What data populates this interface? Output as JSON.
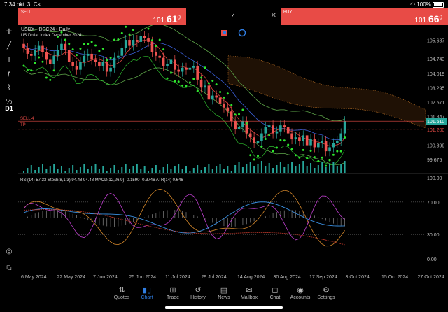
{
  "status_bar": {
    "time": "7:34",
    "date": "okt. 3. Cs",
    "battery": "100%"
  },
  "trade": {
    "sell_label": "SELL",
    "sell_price_main": "101.",
    "sell_price_big": "61",
    "sell_price_sup": "0",
    "buy_label": "BUY",
    "buy_price_main": "101.",
    "buy_price_big": "66",
    "buy_price_sup": "0",
    "quantity": "4"
  },
  "toolbar": {
    "items": [
      "crosshair-icon",
      "line-tool-icon",
      "text-tool-icon",
      "function-icon",
      "indicator-icon",
      "percent-icon"
    ],
    "timeframe": "D1"
  },
  "chart_header": {
    "symbol": "USDX - DEC24 • Daily",
    "name": "US Dollar Index December 2024"
  },
  "order_labels": {
    "sell": "SELL 4",
    "tp": "TP"
  },
  "indicator_label": "RSI(14) 57.33 Stoch(8,1,3) 94.48 94.48 MACD(12,26,9) -0.1590 -0.3746 ATR(14) 0.646",
  "colors": {
    "accent": "#2f7de1",
    "sell": "#e84b46",
    "bull": "#26a69a",
    "bear": "#ef5350"
  },
  "chart_data": {
    "type": "candlestick",
    "price_ticks": [
      "105.687",
      "104.743",
      "104.019",
      "103.295",
      "102.571",
      "101.847",
      "101.610",
      "101.200",
      "100.399",
      "99.675"
    ],
    "price_tick_values": [
      105.687,
      104.743,
      104.019,
      103.295,
      102.571,
      101.847,
      101.61,
      101.2,
      100.399,
      99.675
    ],
    "price_range": [
      99.4,
      106.3
    ],
    "current_price": "101.610",
    "tp_price": "101.200",
    "osc_ticks": [
      "100.00",
      "70.00",
      "30.00",
      "0.00"
    ],
    "osc_tick_values": [
      100,
      70,
      30,
      0
    ],
    "x_labels": [
      "6 May 2024",
      "22 May 2024",
      "7 Jun 2024",
      "25 Jun 2024",
      "11 Jul 2024",
      "29 Jul 2024",
      "14 Aug 2024",
      "30 Aug 2024",
      "17 Sep 2024",
      "3 Oct 2024",
      "15 Oct 2024",
      "27 Oct 2024"
    ],
    "close": [
      105.3,
      105.0,
      104.9,
      105.2,
      105.4,
      105.1,
      104.7,
      104.5,
      104.9,
      105.2,
      105.5,
      105.2,
      104.6,
      104.4,
      104.2,
      104.6,
      104.9,
      105.0,
      104.7,
      104.6,
      104.4,
      104.6,
      104.1,
      104.3,
      104.8,
      104.9,
      105.3,
      105.7,
      105.4,
      105.7,
      105.6,
      105.9,
      105.8,
      105.6,
      105.1,
      104.9,
      104.8,
      104.4,
      104.5,
      104.7,
      104.2,
      104.1,
      104.3,
      104.2,
      104.3,
      104.4,
      103.7,
      103.3,
      103.4,
      102.7,
      102.9,
      102.8,
      102.5,
      102.3,
      102.1,
      101.6,
      101.2,
      101.3,
      101.6,
      101.0,
      100.8,
      100.5,
      100.6,
      101.0,
      101.3,
      101.4,
      101.0,
      101.1,
      101.4,
      101.3,
      101.0,
      100.7,
      100.8,
      100.6,
      100.9,
      100.4,
      100.7,
      100.3,
      100.5,
      100.6,
      100.1,
      100.3,
      100.5,
      100.6,
      101.0,
      101.61
    ]
  }
}
